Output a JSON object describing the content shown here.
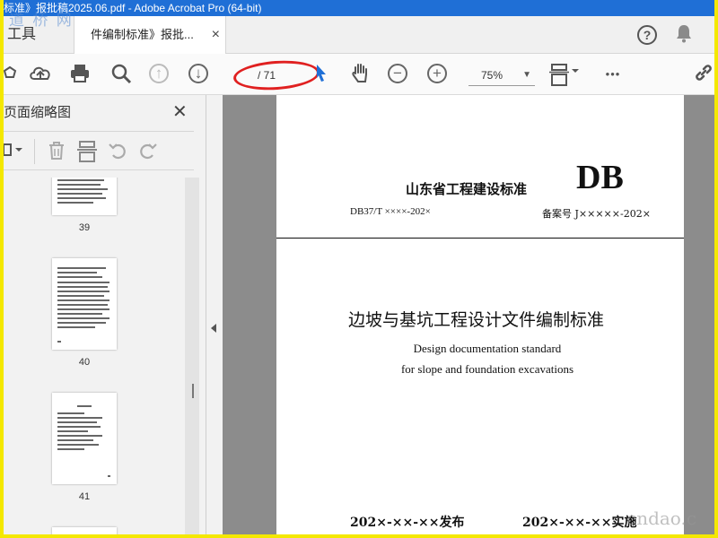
{
  "window": {
    "title": "标准》报批稿2025.06.pdf - Adobe Acrobat Pro (64-bit)"
  },
  "watermark": {
    "text": "道 桥 网"
  },
  "tabs": {
    "tools_label": "工具",
    "doc_label": "件编制标准》报批...",
    "close_glyph": "×"
  },
  "header": {
    "help_glyph": "?",
    "bell_glyph": "🔔"
  },
  "toolbar": {
    "page_of": "/ 71",
    "zoom": "75%",
    "zoom_caret": "▼",
    "more": "•••",
    "minus": "−",
    "plus": "+",
    "up": "↑",
    "down": "↓"
  },
  "sidebar": {
    "title": "页面缩略图",
    "close_glyph": "✕",
    "thumbnails": [
      {
        "page": "39"
      },
      {
        "page": "40"
      },
      {
        "page": "41"
      }
    ]
  },
  "document": {
    "org": "山东省工程建设标准",
    "db": "DB",
    "code": "DB37/T    ××××-202×",
    "record": "备案号 J×××××-202×",
    "title_cn": "边坡与基坑工程设计文件编制标准",
    "title_en_1": "Design documentation standard",
    "title_en_2": "for slope and foundation excavations",
    "published": "202×-××-××发布",
    "implemented": "202×-××-××实施"
  },
  "site_mark": {
    "text": "cndao.c"
  },
  "colors": {
    "titlebar": "#1f6fd6",
    "highlight_ellipse": "#e02020",
    "frame_border": "#f4e800"
  }
}
